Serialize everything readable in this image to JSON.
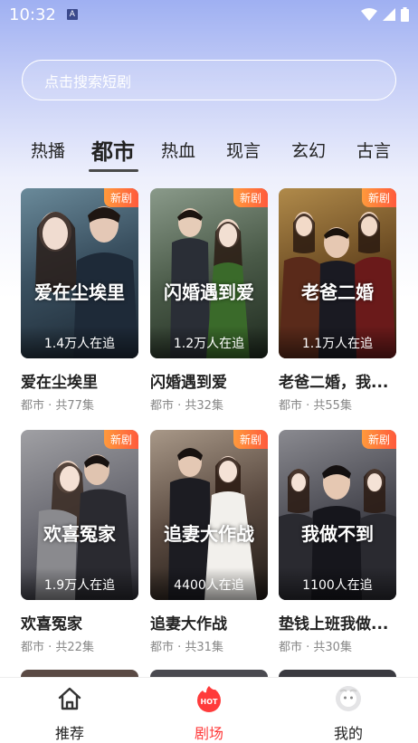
{
  "status": {
    "time": "10:32",
    "indicator": "A"
  },
  "search": {
    "placeholder": "点击搜索短剧"
  },
  "tabs": [
    {
      "label": "热播",
      "active": false
    },
    {
      "label": "都市",
      "active": true
    },
    {
      "label": "热血",
      "active": false
    },
    {
      "label": "现言",
      "active": false
    },
    {
      "label": "玄幻",
      "active": false
    },
    {
      "label": "古言",
      "active": false
    }
  ],
  "cards": [
    {
      "poster_title": "爱在尘埃里",
      "badge": "新剧",
      "watching": "1.4万人在追",
      "title": "爱在尘埃里",
      "sub": "都市 · 共77集",
      "colors": [
        "#4a6a7a",
        "#1f2e3a"
      ]
    },
    {
      "poster_title": "闪婚遇到爱",
      "badge": "新剧",
      "watching": "1.2万人在追",
      "title": "闪婚遇到爱",
      "sub": "都市 · 共32集",
      "colors": [
        "#5a6e5a",
        "#2a3a2c"
      ]
    },
    {
      "poster_title": "老爸二婚",
      "badge": "新剧",
      "watching": "1.1万人在追",
      "title": "老爸二婚，我...",
      "sub": "都市 · 共55集",
      "colors": [
        "#8a6a3a",
        "#3a2a18"
      ]
    },
    {
      "poster_title": "欢喜冤家",
      "badge": "新剧",
      "watching": "1.9万人在追",
      "title": "欢喜冤家",
      "sub": "都市 · 共22集",
      "colors": [
        "#7a7a80",
        "#3c3c44"
      ]
    },
    {
      "poster_title": "追妻大作战",
      "badge": "新剧",
      "watching": "4400人在追",
      "title": "追妻大作战",
      "sub": "都市 · 共31集",
      "colors": [
        "#8a7a6a",
        "#2a2420"
      ]
    },
    {
      "poster_title": "我做不到",
      "badge": "新剧",
      "watching": "1100人在追",
      "title": "垫钱上班我做...",
      "sub": "都市 · 共30集",
      "colors": [
        "#5a5a60",
        "#1c1c22"
      ]
    }
  ],
  "nav": [
    {
      "label": "推荐",
      "icon": "home-icon",
      "active": false
    },
    {
      "label": "剧场",
      "icon": "hot-icon",
      "active": true,
      "icon_text": "HOT"
    },
    {
      "label": "我的",
      "icon": "profile-icon",
      "active": false
    }
  ],
  "colors": {
    "accent": "#ff3b3b",
    "badge": "#ff6a3c"
  }
}
